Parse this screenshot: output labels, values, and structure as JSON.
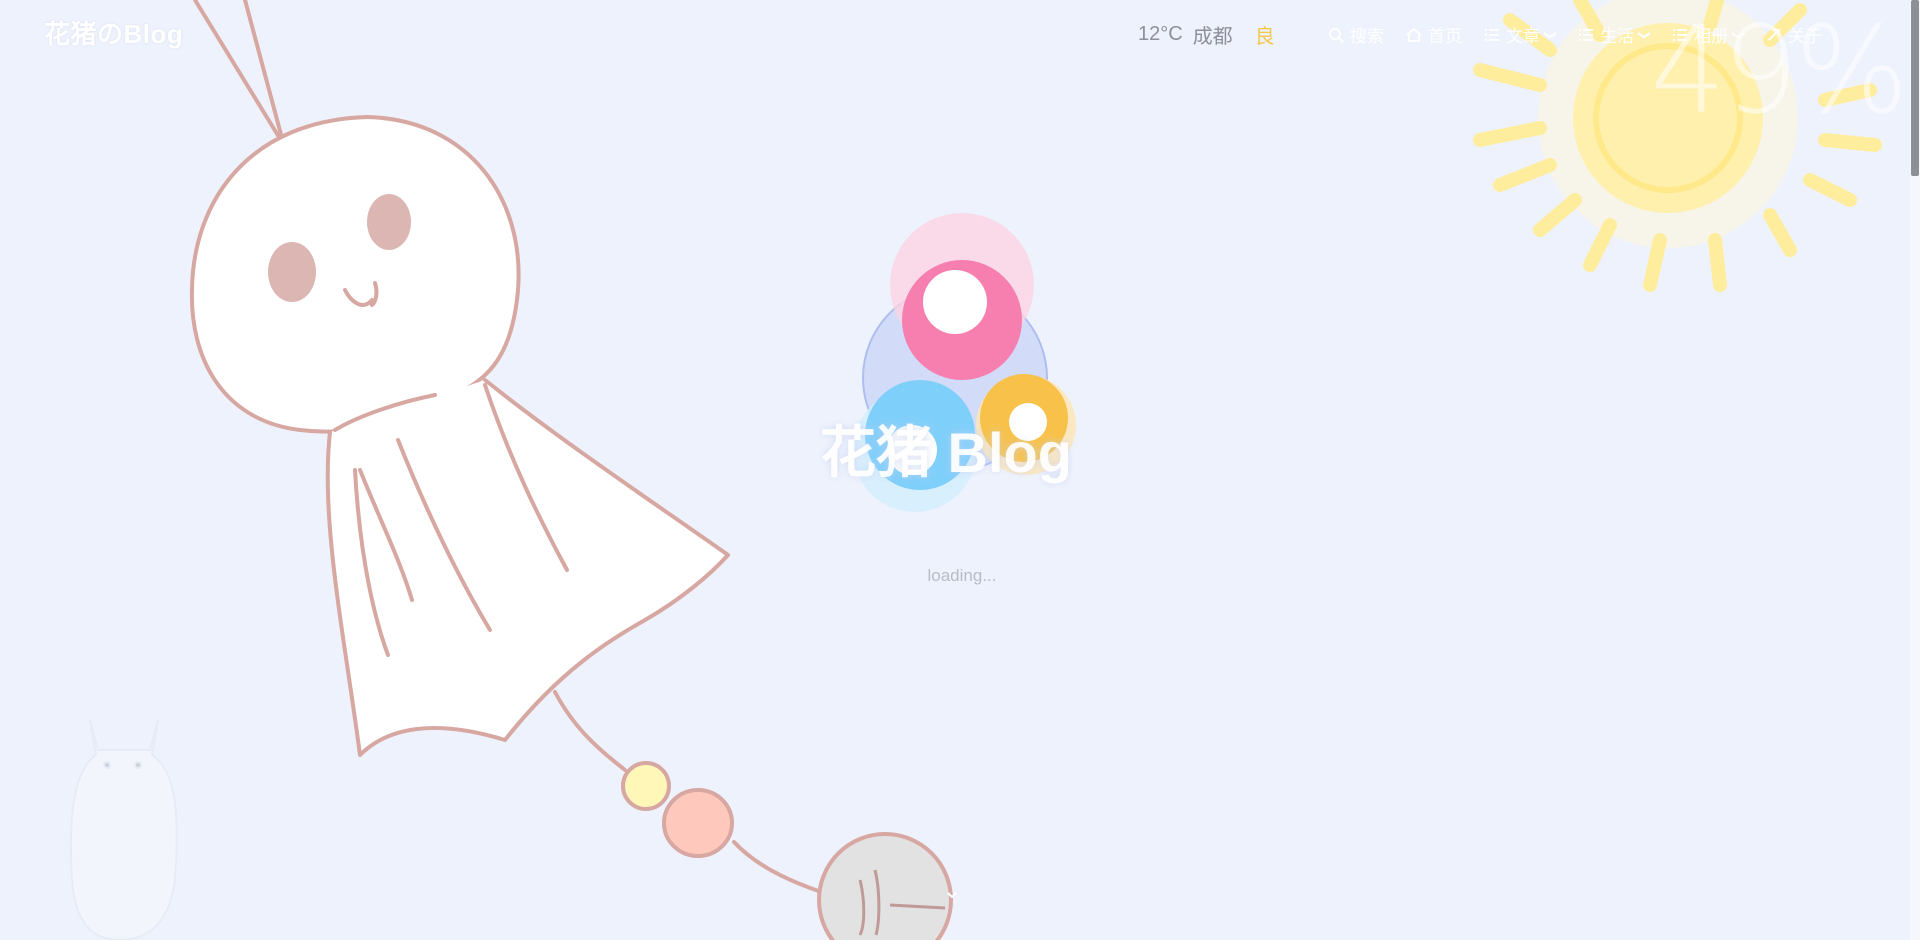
{
  "site": {
    "title": "花猪のBlog",
    "hero_title": "花猪 Blog"
  },
  "weather": {
    "temperature": "12°C",
    "city": "成都",
    "air_quality": "良"
  },
  "nav": {
    "items": [
      {
        "label": "搜索",
        "icon": "search-icon",
        "has_dropdown": false
      },
      {
        "label": "首页",
        "icon": "home-icon",
        "has_dropdown": false
      },
      {
        "label": "文章",
        "icon": "list-icon",
        "has_dropdown": true
      },
      {
        "label": "生活",
        "icon": "list-icon",
        "has_dropdown": true
      },
      {
        "label": "相册",
        "icon": "list-icon",
        "has_dropdown": true
      },
      {
        "label": "关于",
        "icon": "link-icon",
        "has_dropdown": false
      }
    ]
  },
  "loader": {
    "text": "loading...",
    "percent_label": "49%"
  },
  "colors": {
    "background": "#eef2fd",
    "gear_pink": "#f77fb0",
    "gear_blue": "#7fcffb",
    "gear_yellow": "#f8c24a",
    "sun": "#fff2b0"
  }
}
